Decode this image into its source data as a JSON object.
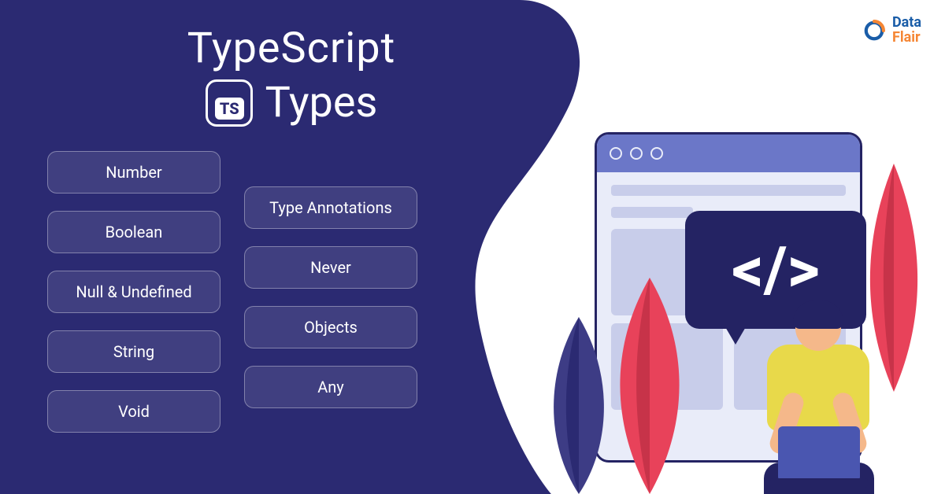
{
  "title": {
    "line1": "TypeScript",
    "line2": "Types",
    "badge": "TS"
  },
  "types_left": [
    "Number",
    "Boolean",
    "Null & Undefined",
    "String",
    "Void"
  ],
  "types_right": [
    "Type Annotations",
    "Never",
    "Objects",
    "Any"
  ],
  "logo": {
    "line1": "Data",
    "line2": "Flair"
  },
  "speech_symbol": "</>",
  "colors": {
    "primary_bg": "#2b2a72",
    "accent1": "#e8425a",
    "accent2": "#6b77c8",
    "accent3": "#e8d94a"
  }
}
